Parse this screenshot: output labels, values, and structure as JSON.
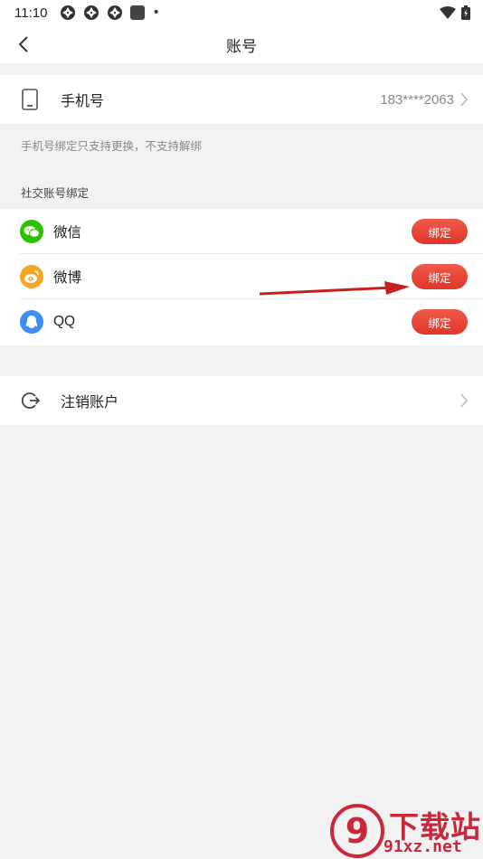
{
  "status_bar": {
    "time": "11:10",
    "dot": "•"
  },
  "header": {
    "title": "账号"
  },
  "phone": {
    "label": "手机号",
    "value": "183****2063"
  },
  "phone_note": "手机号绑定只支持更换，不支持解绑",
  "social": {
    "section_title": "社交账号绑定",
    "items": [
      {
        "label": "微信",
        "button": "绑定",
        "icon": "wechat-icon",
        "color": "#2dc100"
      },
      {
        "label": "微博",
        "button": "绑定",
        "icon": "weibo-icon",
        "color": "#f5a623"
      },
      {
        "label": "QQ",
        "button": "绑定",
        "icon": "qq-icon",
        "color": "#3d8ef7"
      }
    ]
  },
  "cancel_account": {
    "label": "注销账户"
  },
  "watermark": {
    "top": "下载站",
    "bottom": "91xz.net",
    "logo": "9"
  },
  "colors": {
    "accent": "#e53a2f",
    "background": "#f2f2f2",
    "watermark": "#c9273a"
  }
}
